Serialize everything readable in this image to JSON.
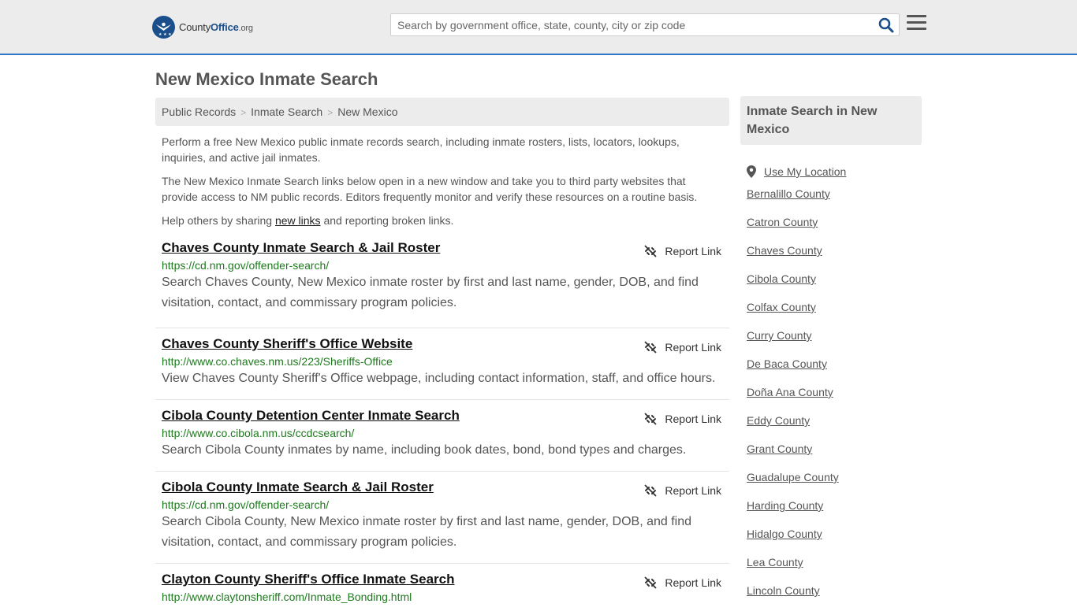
{
  "header": {
    "logo_brand": "County",
    "logo_brand2": "Office",
    "logo_tld": ".org",
    "search_placeholder": "Search by government office, state, county, city or zip code"
  },
  "page": {
    "title": "New Mexico Inmate Search"
  },
  "breadcrumb": [
    "Public Records",
    "Inmate Search",
    "New Mexico"
  ],
  "intro": {
    "p1": "Perform a free New Mexico public inmate records search, including inmate rosters, lists, locators, lookups, inquiries, and active jail inmates.",
    "p2": "The New Mexico Inmate Search links below open in a new window and take you to third party websites that provide access to NM public records. Editors frequently monitor and verify these resources on a routine basis.",
    "p3_before": "Help others by sharing ",
    "p3_link": "new links",
    "p3_after": " and reporting broken links."
  },
  "report_label": "Report Link",
  "results": [
    {
      "title": "Chaves County Inmate Search & Jail Roster",
      "url": "https://cd.nm.gov/offender-search/",
      "desc": "Search Chaves County, New Mexico inmate roster by first and last name, gender, DOB, and find visitation, contact, and commissary program policies."
    },
    {
      "title": "Chaves County Sheriff's Office Website",
      "url": "http://www.co.chaves.nm.us/223/Sheriffs-Office",
      "desc": "View Chaves County Sheriff's Office webpage, including contact information, staff, and office hours."
    },
    {
      "title": "Cibola County Detention Center Inmate Search",
      "url": "http://www.co.cibola.nm.us/ccdcsearch/",
      "desc": "Search Cibola County inmates by name, including book dates, bond, bond types and charges."
    },
    {
      "title": "Cibola County Inmate Search & Jail Roster",
      "url": "https://cd.nm.gov/offender-search/",
      "desc": "Search Cibola County, New Mexico inmate roster by first and last name, gender, DOB, and find visitation, contact, and commissary program policies."
    },
    {
      "title": "Clayton County Sheriff's Office Inmate Search",
      "url": "http://www.claytonsheriff.com/Inmate_Bonding.html",
      "desc": ""
    }
  ],
  "sidebar": {
    "heading": "Inmate Search in New Mexico",
    "use_location": "Use My Location",
    "counties": [
      "Bernalillo County",
      "Catron County",
      "Chaves County",
      "Cibola County",
      "Colfax County",
      "Curry County",
      "De Baca County",
      "Doña Ana County",
      "Eddy County",
      "Grant County",
      "Guadalupe County",
      "Harding County",
      "Hidalgo County",
      "Lea County",
      "Lincoln County"
    ]
  },
  "colors": {
    "accent": "#2f77c6",
    "brand": "#1a4f8b",
    "url_green": "#1e7a1e"
  }
}
